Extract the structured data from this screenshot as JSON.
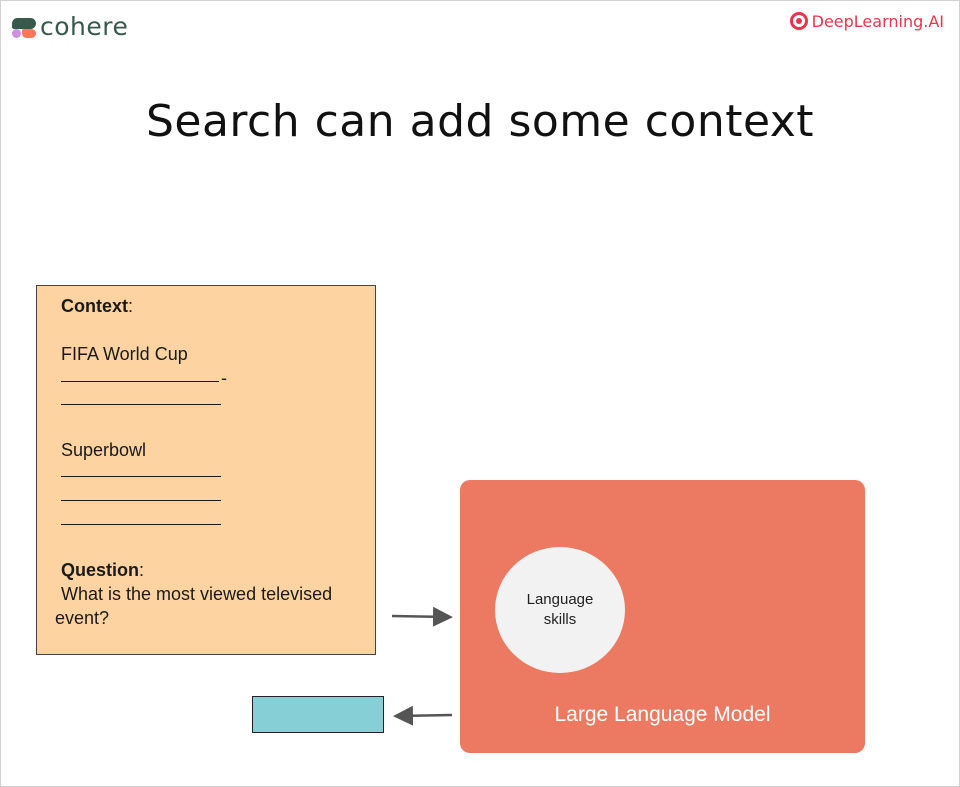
{
  "header": {
    "left_logo": "cohere",
    "right_logo": "DeepLearning.AI",
    "brand_colors": {
      "cohere": "#39594d",
      "deeplearning": "#e8344e"
    }
  },
  "title": "Search can add some context",
  "context_box": {
    "context_label": "Context",
    "context_colon": ":",
    "item1": "FIFA World Cup",
    "item1_dash_suffix": "-",
    "item2": "Superbowl",
    "question_label": "Question",
    "question_colon": ":",
    "question_line1": "What is the most viewed televised",
    "question_line2": "event?",
    "background": "#fdd4a1"
  },
  "model": {
    "circle_line1": "Language",
    "circle_line2": "skills",
    "label": "Large Language Model",
    "background": "#ec7a63"
  },
  "output_box": {
    "background": "#86cfd6"
  }
}
